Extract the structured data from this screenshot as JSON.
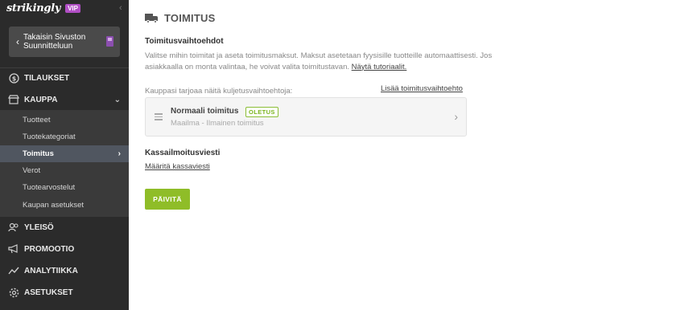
{
  "sidebar": {
    "brand": "strikingly",
    "vip": "VIP",
    "back_label": "Takaisin Sivuston Suunnitteluun",
    "nav": {
      "orders": "TILAUKSET",
      "store": "KAUPPA",
      "audience": "YLEISÖ",
      "promotion": "PROMOOTIO",
      "analytics": "ANALYTIIKKA",
      "settings": "ASETUKSET"
    },
    "store_sub": {
      "products": "Tuotteet",
      "categories": "Tuotekategoriat",
      "shipping": "Toimitus",
      "taxes": "Verot",
      "reviews": "Tuotearvostelut",
      "store_settings": "Kaupan asetukset"
    }
  },
  "main": {
    "title": "TOIMITUS",
    "options_title": "Toimitusvaihtoehdot",
    "options_desc": "Valitse mihin toimitat ja aseta toimitusmaksut. Maksut asetetaan fyysisille tuotteille automaattisesti. Jos asiakkaalla on monta valintaa, he voivat valita toimitustavan.",
    "tutorial_link": "Näytä tutoriaalit.",
    "carriers_label": "Kauppasi tarjoaa näitä kuljetusvaihtoehtoja:",
    "add_option_link": "Lisää toimitusvaihtoehto",
    "option": {
      "name": "Normaali toimitus",
      "badge": "OLETUS",
      "detail": "Maailma - Ilmainen toimitus"
    },
    "checkout_title": "Kassailmoitusviesti",
    "checkout_link": "Määritä kassaviesti",
    "update_button": "PÄIVITÄ"
  },
  "colors": {
    "sidebar_bg": "#2b2b2b",
    "accent_green": "#8fbd28",
    "vip_purple": "#b14fc5"
  }
}
